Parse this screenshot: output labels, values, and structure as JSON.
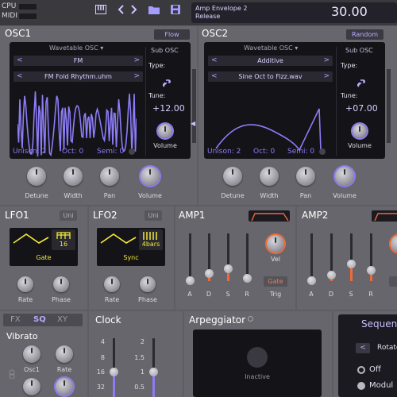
{
  "top": {
    "cpu_label": "CPU",
    "midi_label": "MIDI",
    "patch_line1": "Amp Envelope 2",
    "patch_line2": "Release",
    "tempo": "30.00",
    "icons": [
      "keyboard-icon",
      "chevron-left-icon",
      "chevron-right-icon",
      "folder-icon",
      "save-icon"
    ]
  },
  "osc1": {
    "title": "OSC1",
    "mode_button": "Flow",
    "type_select": "Wavetable OSC",
    "wave_select": "FM",
    "file_select": "FM Fold Rhythm.uhm",
    "sub_title": "Sub OSC",
    "type_label": "Type:",
    "tune_label": "Tune:",
    "tune_value": "+12.00",
    "volume_label": "Volume",
    "unison": "Unison: 2",
    "oct": "Oct:  0",
    "semi": "Semi:  0",
    "knobs": [
      "Detune",
      "Width",
      "Pan",
      "Volume"
    ]
  },
  "osc2": {
    "title": "OSC2",
    "mode_button": "Random",
    "type_select": "Wavetable OSC",
    "wave_select": "Additive",
    "file_select": "Sine Oct to Fizz.wav",
    "sub_title": "Sub OSC",
    "type_label": "Type:",
    "tune_label": "Tune:",
    "tune_value": "+07.00",
    "volume_label": "Volume",
    "unison": "Unison: 2",
    "oct": "Oct:  0",
    "semi": "Semi:  0",
    "knobs": [
      "Detune",
      "Width",
      "Pan",
      "Volume"
    ]
  },
  "lfo1": {
    "title": "LFO1",
    "uni": "Uni",
    "value": "16",
    "mode": "Gate",
    "knobs": [
      "Rate",
      "Phase"
    ]
  },
  "lfo2": {
    "title": "LFO2",
    "uni": "Uni",
    "value": "4bars",
    "mode": "Sync",
    "knobs": [
      "Rate",
      "Phase"
    ]
  },
  "amp1": {
    "title": "AMP1",
    "faders": [
      "A",
      "D",
      "S",
      "R"
    ],
    "vel_label": "Vel",
    "trig_button": "Gate",
    "trig_label": "Trig"
  },
  "amp2": {
    "title": "AMP2",
    "faders": [
      "A",
      "D",
      "S",
      "R"
    ]
  },
  "fx": {
    "tabs": [
      "FX",
      "SQ",
      "XY"
    ],
    "active_tab": "SQ",
    "section": "Vibrato",
    "knobs": [
      "Osc1",
      "Rate"
    ]
  },
  "clock": {
    "title": "Clock",
    "scale1": [
      "4",
      "8",
      "16",
      "32"
    ],
    "scale2": [
      "2",
      "1.5",
      "1",
      "0.5"
    ]
  },
  "arp": {
    "title": "Arpeggiator",
    "status": "Inactive"
  },
  "seq": {
    "title": "Sequen",
    "rotate": "Rotate",
    "off": "Off",
    "modul": "Modul"
  }
}
